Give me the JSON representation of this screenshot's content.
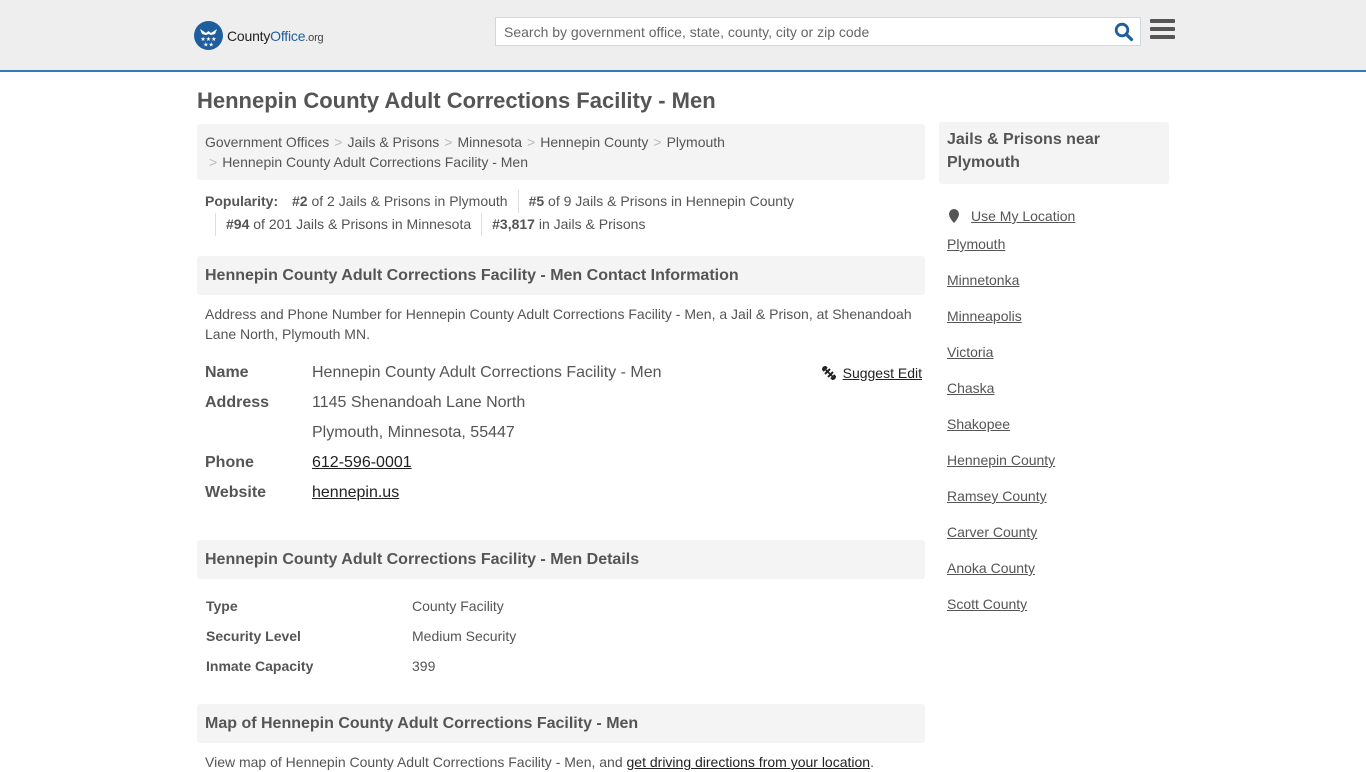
{
  "header": {
    "logo": {
      "county": "County",
      "office": "Office",
      "org": ".org"
    },
    "search_placeholder": "Search by government office, state, county, city or zip code",
    "brand_color": "#1f5e9e",
    "accent_border": "#337ab7"
  },
  "page_title": "Hennepin County Adult Corrections Facility - Men",
  "breadcrumb": [
    "Government Offices",
    "Jails & Prisons",
    "Minnesota",
    "Hennepin County",
    "Plymouth",
    "Hennepin County Adult Corrections Facility - Men"
  ],
  "popularity": {
    "label": "Popularity:",
    "items": [
      {
        "rank": "#2",
        "text": " of 2 Jails & Prisons in Plymouth"
      },
      {
        "rank": "#5",
        "text": " of 9 Jails & Prisons in Hennepin County"
      },
      {
        "rank": "#94",
        "text": " of 201 Jails & Prisons in Minnesota"
      },
      {
        "rank": "#3,817",
        "text": " in Jails & Prisons"
      }
    ]
  },
  "contact": {
    "heading": "Hennepin County Adult Corrections Facility - Men Contact Information",
    "description": "Address and Phone Number for Hennepin County Adult Corrections Facility - Men, a Jail & Prison, at Shenandoah Lane North, Plymouth MN.",
    "suggest_edit": "Suggest Edit",
    "name_label": "Name",
    "name": "Hennepin County Adult Corrections Facility - Men",
    "address_label": "Address",
    "address_line1": "1145 Shenandoah Lane North",
    "address_line2": "Plymouth, Minnesota, 55447",
    "phone_label": "Phone",
    "phone": "612-596-0001",
    "website_label": "Website",
    "website": "hennepin.us"
  },
  "details": {
    "heading": "Hennepin County Adult Corrections Facility - Men Details",
    "rows": [
      {
        "label": "Type",
        "value": "County Facility"
      },
      {
        "label": "Security Level",
        "value": "Medium Security"
      },
      {
        "label": "Inmate Capacity",
        "value": "399"
      }
    ]
  },
  "map": {
    "heading": "Map of Hennepin County Adult Corrections Facility - Men",
    "text": "View map of Hennepin County Adult Corrections Facility - Men, and ",
    "link": "get driving directions from your location",
    "suffix": "."
  },
  "sidebar": {
    "heading": "Jails & Prisons near Plymouth",
    "use_location": "Use My Location",
    "links": [
      "Plymouth",
      "Minnetonka",
      "Minneapolis",
      "Victoria",
      "Chaska",
      "Shakopee",
      "Hennepin County",
      "Ramsey County",
      "Carver County",
      "Anoka County",
      "Scott County"
    ]
  }
}
